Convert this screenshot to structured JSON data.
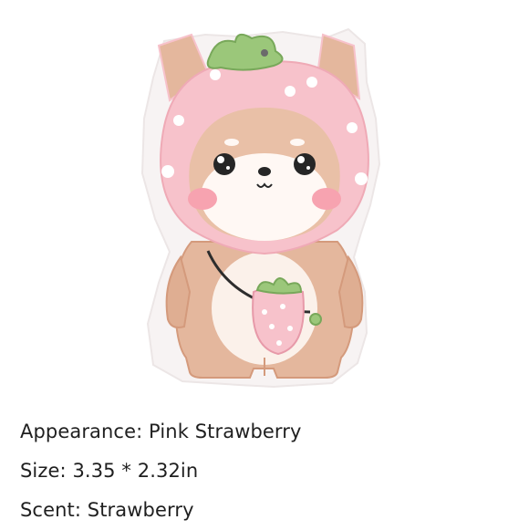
{
  "illustration": {
    "subject": "shiba-dog-strawberry-hood-sticker",
    "colors": {
      "outline": "#f6f2f2",
      "fur": "#e4b79d",
      "fur_dark": "#d7a184",
      "belly": "#fbf1ea",
      "hood": "#f7c2cb",
      "hood_edge": "#efaab6",
      "leaf": "#9bc77a",
      "blush": "#f7a3b0",
      "eye": "#262626"
    }
  },
  "specs": [
    "Appearance: Pink Strawberry",
    "Size: 3.35 * 2.32in",
    "Scent: Strawberry"
  ]
}
